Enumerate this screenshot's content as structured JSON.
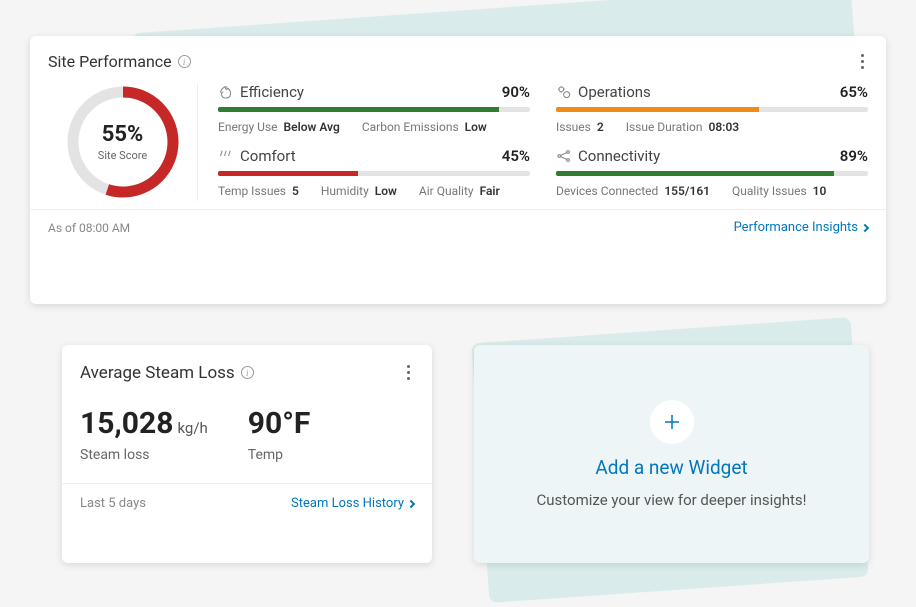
{
  "sitePerf": {
    "title": "Site Performance",
    "gauge": {
      "pct": 55,
      "pctText": "55%",
      "label": "Site Score"
    },
    "metrics": [
      {
        "name": "Efficiency",
        "pct": 90,
        "pctText": "90%",
        "color": "green",
        "stats": [
          {
            "label": "Energy Use",
            "val": "Below Avg"
          },
          {
            "label": "Carbon Emissions",
            "val": "Low"
          }
        ]
      },
      {
        "name": "Operations",
        "pct": 65,
        "pctText": "65%",
        "color": "orange",
        "stats": [
          {
            "label": "Issues",
            "val": "2"
          },
          {
            "label": "Issue Duration",
            "val": "08:03"
          }
        ]
      },
      {
        "name": "Comfort",
        "pct": 45,
        "pctText": "45%",
        "color": "red",
        "stats": [
          {
            "label": "Temp Issues",
            "val": "5"
          },
          {
            "label": "Humidity",
            "val": "Low"
          },
          {
            "label": "Air Quality",
            "val": "Fair"
          }
        ]
      },
      {
        "name": "Connectivity",
        "pct": 89,
        "pctText": "89%",
        "color": "green",
        "stats": [
          {
            "label": "Devices Connected",
            "val": "155/161"
          },
          {
            "label": "Quality Issues",
            "val": "10"
          }
        ]
      }
    ],
    "asOf": "As of 08:00 AM",
    "link": "Performance Insights"
  },
  "steam": {
    "title": "Average Steam Loss",
    "loss": {
      "val": "15,028",
      "unit": "kg/h",
      "label": "Steam loss"
    },
    "temp": {
      "val": "90°F",
      "label": "Temp"
    },
    "footer": {
      "range": "Last 5 days",
      "link": "Steam Loss History"
    }
  },
  "addWidget": {
    "title": "Add a new Widget",
    "subtitle": "Customize your view for deeper insights!"
  }
}
